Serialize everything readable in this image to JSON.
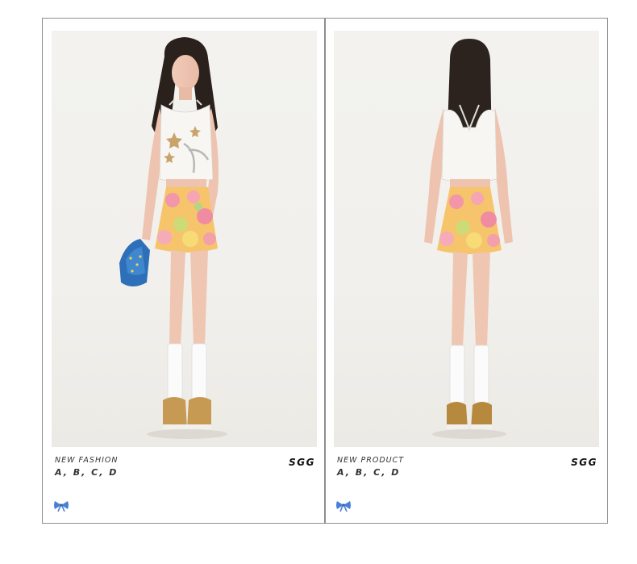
{
  "cards": [
    {
      "caption_title": "NEW FASHION",
      "caption_options": "A, B, C, D",
      "brand": "SGG",
      "icon": "bow-icon",
      "view": "front"
    },
    {
      "caption_title": "NEW PRODUCT",
      "caption_options": "A, B, C, D",
      "brand": "SGG",
      "icon": "bow-icon",
      "view": "back"
    }
  ],
  "colors": {
    "frame_border": "#8e8e8e",
    "bow": "#4a7fd6",
    "photo_background": "#f2f1ee"
  }
}
